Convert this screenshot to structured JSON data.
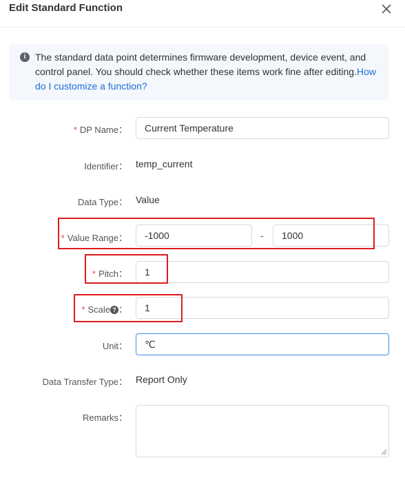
{
  "dialog": {
    "title": "Edit Standard Function",
    "close_icon": "close-icon"
  },
  "notice": {
    "icon": "info-icon",
    "text": "The standard data point determines firmware development, device event, and control panel. You should check whether these items work fine after editing.",
    "link": "How do I customize a function?"
  },
  "form": {
    "dp_name": {
      "label": "DP Name：",
      "value": "Current Temperature"
    },
    "identifier": {
      "label": "Identifier：",
      "value": "temp_current"
    },
    "data_type": {
      "label": "Data Type：",
      "value": "Value"
    },
    "value_range": {
      "label": "Value Range：",
      "min": "-1000",
      "separator": "-",
      "max": "1000"
    },
    "pitch": {
      "label": "Pitch：",
      "value": "1"
    },
    "scale": {
      "label": "Scale",
      "colon": "：",
      "value": "1",
      "help_icon": "question-circle-icon"
    },
    "unit": {
      "label": "Unit：",
      "value": "℃"
    },
    "data_transfer_type": {
      "label": "Data Transfer Type：",
      "value": "Report Only"
    },
    "remarks": {
      "label": "Remarks：",
      "value": ""
    },
    "required_mark": "*"
  },
  "colors": {
    "link": "#1c6fd6",
    "required": "#e04c4c",
    "highlight_box": "#e01c1c",
    "focus_border": "#3c8cf0",
    "notice_bg": "#f4f7fc"
  }
}
